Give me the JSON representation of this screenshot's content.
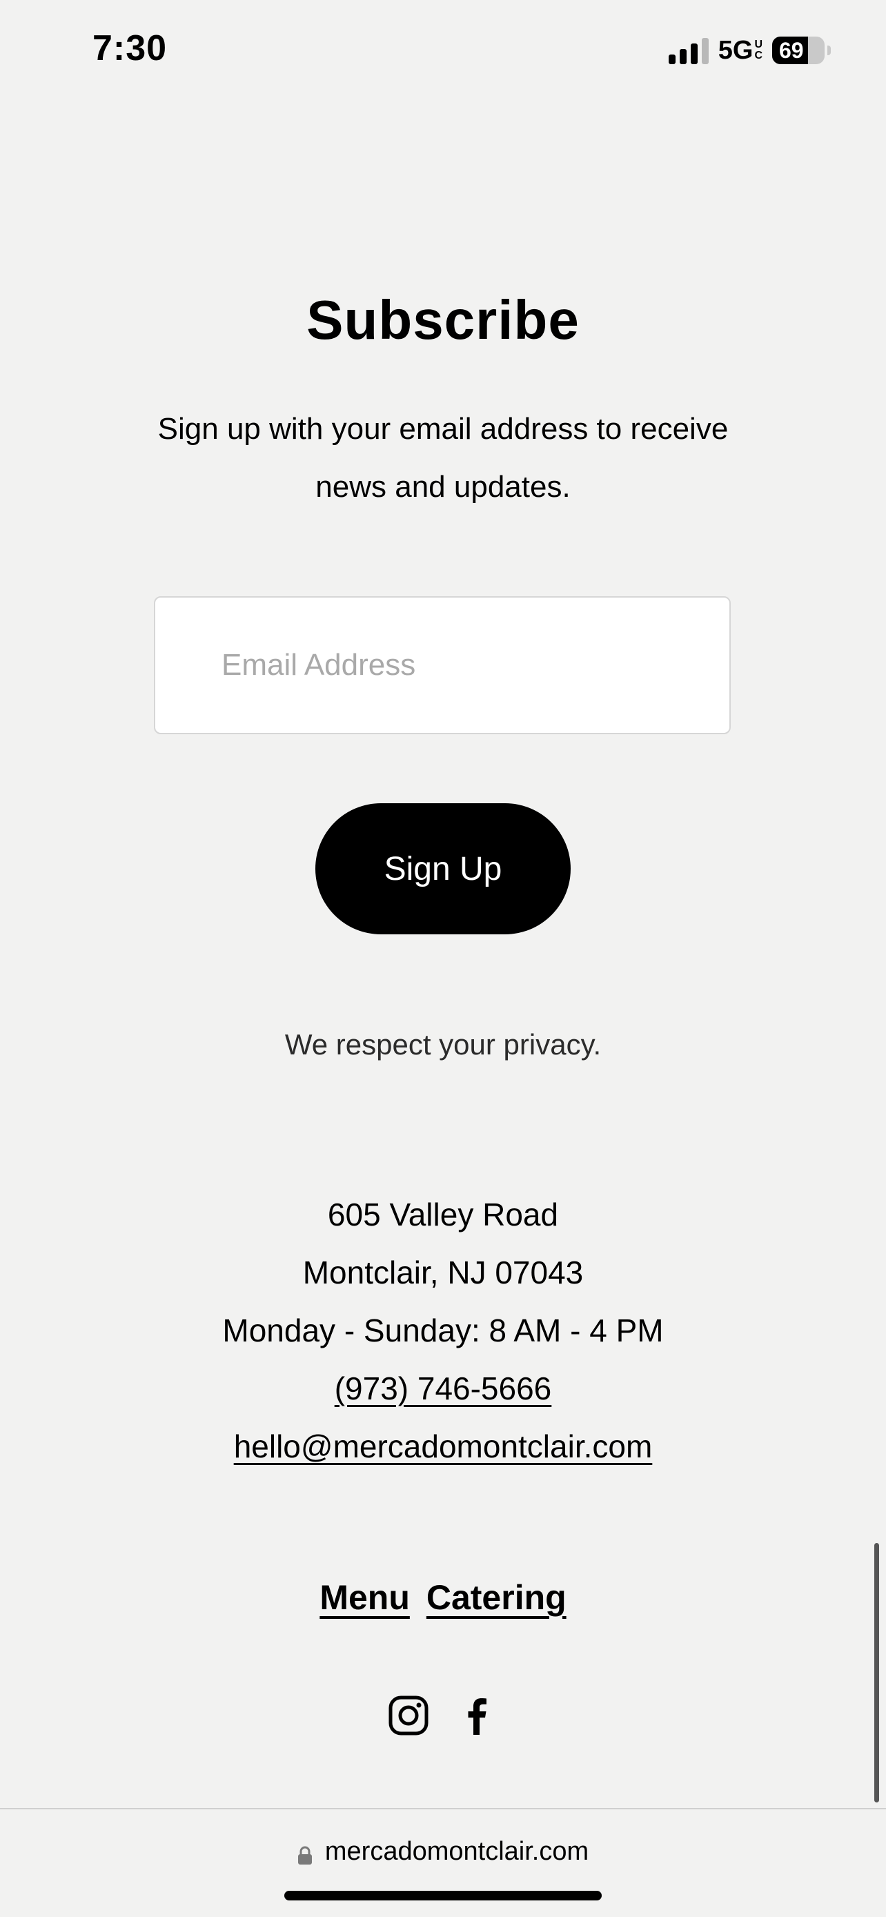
{
  "status_bar": {
    "time": "7:30",
    "network": "5G",
    "network_suffix_top": "U",
    "network_suffix_bottom": "C",
    "battery_level": "69",
    "battery_percent": 69
  },
  "subscribe": {
    "title": "Subscribe",
    "description": "Sign up with your email address to receive news and updates.",
    "email_placeholder": "Email Address",
    "email_value": "",
    "button_label": "Sign Up",
    "privacy_note": "We respect your privacy."
  },
  "contact": {
    "address_line1": "605 Valley Road",
    "address_line2": "Montclair, NJ 07043",
    "hours": "Monday - Sunday: 8 AM - 4 PM",
    "phone": "(973) 746-5666",
    "email": "hello@mercadomontclair.com"
  },
  "footer_nav": {
    "menu_label": "Menu",
    "catering_label": "Catering"
  },
  "social": {
    "icons": [
      "instagram-icon",
      "facebook-icon"
    ]
  },
  "browser": {
    "url": "mercadomontclair.com"
  }
}
